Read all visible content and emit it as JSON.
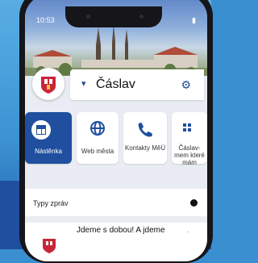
{
  "status_bar": {
    "time": "10:53",
    "right": ""
  },
  "city": {
    "name": "Čáslav"
  },
  "tiles": [
    {
      "label": "Nástěnka",
      "icon": "board-icon",
      "active": true
    },
    {
      "label": "Web města",
      "icon": "globe-icon",
      "active": false
    },
    {
      "label": "Kontakty MěÚ",
      "icon": "phone-icon",
      "active": false
    },
    {
      "label": "Čáslav-mem které mám",
      "icon": "apps-icon",
      "active": false
    }
  ],
  "section": {
    "title": "Typy zpráv"
  },
  "news": {
    "headline": "Jdeme s dobou! A jdeme"
  },
  "colors": {
    "accent": "#1f4f9e",
    "panel": "#ffffff",
    "bg": "#e9edf3"
  }
}
